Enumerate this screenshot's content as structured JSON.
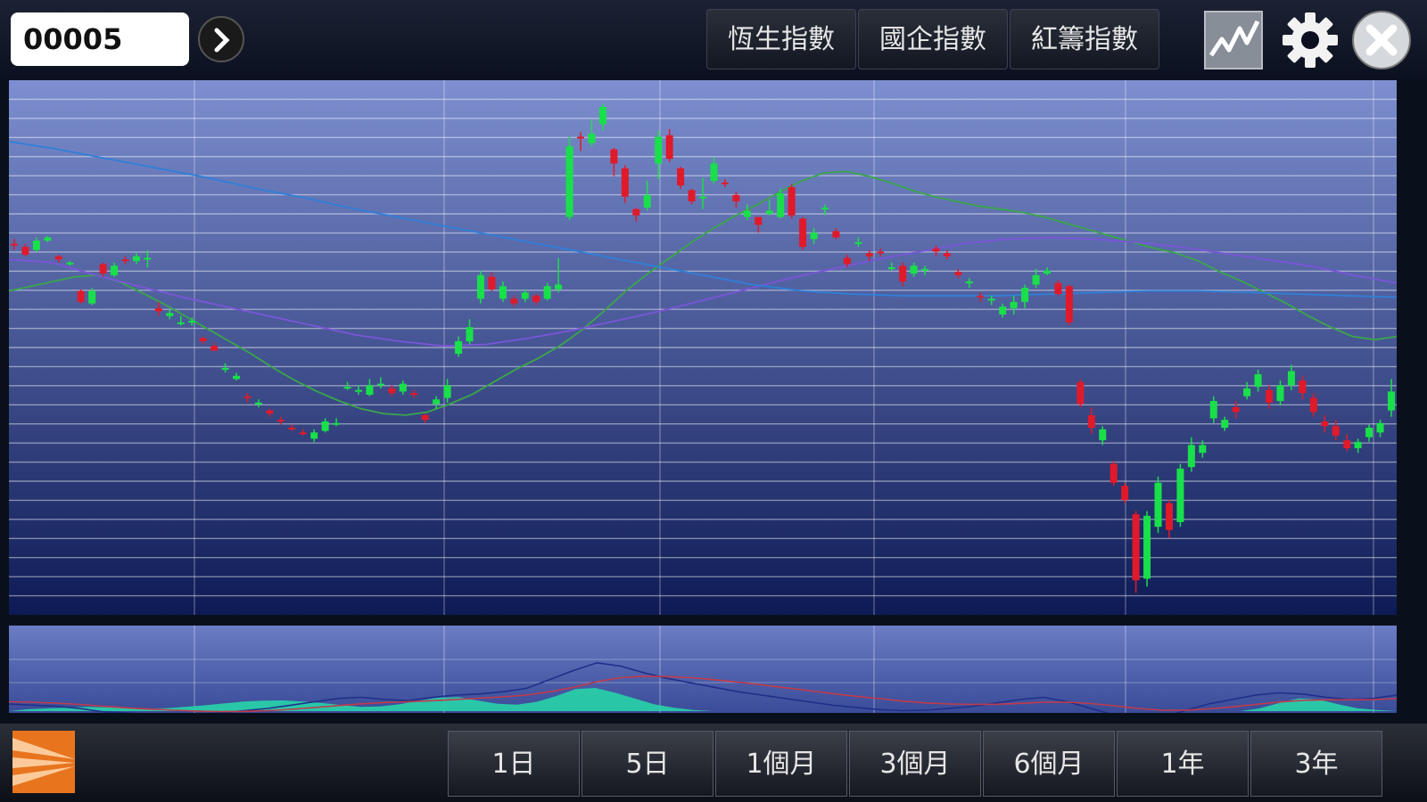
{
  "search": {
    "value": "00005"
  },
  "index_buttons": [
    {
      "label": "恆生指數"
    },
    {
      "label": "國企指數"
    },
    {
      "label": "紅籌指數"
    }
  ],
  "period_buttons": [
    {
      "label": "1日"
    },
    {
      "label": "5日"
    },
    {
      "label": "1個月"
    },
    {
      "label": "3個月"
    },
    {
      "label": "6個月"
    },
    {
      "label": "1年"
    },
    {
      "label": "3年"
    }
  ],
  "icons": {
    "go": "chevron-right-icon",
    "chart_type": "line-chart-icon",
    "settings": "gear-icon",
    "close": "close-icon",
    "logo": "brand-logo"
  },
  "colors": {
    "up": "#19e04a",
    "down": "#e01a2a",
    "ma_short": "#3aa64a",
    "ma_mid": "#7a55d8",
    "ma_long": "#2f7fd8",
    "plot_top": "#7d8fd0",
    "plot_bottom": "#0d1a55",
    "histogram": "#27d4a8"
  },
  "chart_data": {
    "type": "candlestick",
    "y_axis": "right",
    "grid": true,
    "candles": [
      [
        75.6,
        75.5,
        75.9,
        75.2
      ],
      [
        75.4,
        74.9,
        75.6,
        74.8
      ],
      [
        75.2,
        75.8,
        76.0,
        75.1
      ],
      [
        75.8,
        76.0,
        76.1,
        75.7
      ],
      [
        74.8,
        74.6,
        74.9,
        74.4
      ],
      [
        74.3,
        74.4,
        74.5,
        74.2
      ],
      [
        72.6,
        71.9,
        72.7,
        71.8
      ],
      [
        71.8,
        72.6,
        72.8,
        71.7
      ],
      [
        74.3,
        73.7,
        74.4,
        73.5
      ],
      [
        73.6,
        74.2,
        74.4,
        73.5
      ],
      [
        74.6,
        74.5,
        74.8,
        74.3
      ],
      [
        74.5,
        74.8,
        75.0,
        74.3
      ],
      [
        74.7,
        74.7,
        75.2,
        74.1
      ],
      [
        71.5,
        71.3,
        71.9,
        71.0
      ],
      [
        71.0,
        71.2,
        71.4,
        70.8
      ],
      [
        70.6,
        70.6,
        71.0,
        70.4
      ],
      [
        70.7,
        70.7,
        70.9,
        70.4
      ],
      [
        69.6,
        69.4,
        69.7,
        69.2
      ],
      [
        69.1,
        68.8,
        69.3,
        68.8
      ],
      [
        67.7,
        67.7,
        68.0,
        67.4
      ],
      [
        67.0,
        67.2,
        67.4,
        66.9
      ],
      [
        65.9,
        65.8,
        66.1,
        65.5
      ],
      [
        65.4,
        65.5,
        65.7,
        65.2
      ],
      [
        65.0,
        64.8,
        65.1,
        64.6
      ],
      [
        64.4,
        64.3,
        64.6,
        64.1
      ],
      [
        63.9,
        63.8,
        64.1,
        63.7
      ],
      [
        63.6,
        63.5,
        63.8,
        63.4
      ],
      [
        63.2,
        63.6,
        63.8,
        63.0
      ],
      [
        63.7,
        64.3,
        64.5,
        63.6
      ],
      [
        64.1,
        64.2,
        64.5,
        64.0
      ],
      [
        66.4,
        66.5,
        66.8,
        66.3
      ],
      [
        66.3,
        66.3,
        66.6,
        66.0
      ],
      [
        66.0,
        66.6,
        67.0,
        65.9
      ],
      [
        66.6,
        66.7,
        67.1,
        66.4
      ],
      [
        66.4,
        66.1,
        66.6,
        65.9
      ],
      [
        66.2,
        66.7,
        66.9,
        66.0
      ],
      [
        66.1,
        66.0,
        66.3,
        65.8
      ],
      [
        64.7,
        64.4,
        64.8,
        64.2
      ],
      [
        65.4,
        65.7,
        65.9,
        65.1
      ],
      [
        65.8,
        66.6,
        67.0,
        65.5
      ],
      [
        68.6,
        69.4,
        69.7,
        68.4
      ],
      [
        69.4,
        70.3,
        70.8,
        69.2
      ],
      [
        72.1,
        73.6,
        73.9,
        71.8
      ],
      [
        73.5,
        72.7,
        73.8,
        72.6
      ],
      [
        72.1,
        72.9,
        73.2,
        71.9
      ],
      [
        72.1,
        71.8,
        72.3,
        71.6
      ],
      [
        72.1,
        72.5,
        72.7,
        71.9
      ],
      [
        72.3,
        71.9,
        72.4,
        71.7
      ],
      [
        72.1,
        72.9,
        73.1,
        72.0
      ],
      [
        72.7,
        73.0,
        74.7,
        72.5
      ],
      [
        77.3,
        81.8,
        82.4,
        77.1
      ],
      [
        82.4,
        82.3,
        82.7,
        81.5
      ],
      [
        82.0,
        82.6,
        83.5,
        81.8
      ],
      [
        83.2,
        84.3,
        84.5,
        82.8
      ],
      [
        81.6,
        80.7,
        81.7,
        79.9
      ],
      [
        80.4,
        78.6,
        80.6,
        78.2
      ],
      [
        77.8,
        77.4,
        77.9,
        77.0
      ],
      [
        77.9,
        78.7,
        79.6,
        77.7
      ],
      [
        80.7,
        82.4,
        82.8,
        79.7
      ],
      [
        82.5,
        81.0,
        82.9,
        80.8
      ],
      [
        80.4,
        79.3,
        80.5,
        79.1
      ],
      [
        79.0,
        78.3,
        79.1,
        78.1
      ],
      [
        78.6,
        78.6,
        79.8,
        77.8
      ],
      [
        79.6,
        80.7,
        81.1,
        79.4
      ],
      [
        79.5,
        79.4,
        79.7,
        79.2
      ],
      [
        78.7,
        78.3,
        78.9,
        77.9
      ],
      [
        77.3,
        77.7,
        78.1,
        77.1
      ],
      [
        77.3,
        76.8,
        77.3,
        76.3
      ],
      [
        77.5,
        77.7,
        78.4,
        77.4
      ],
      [
        77.3,
        78.8,
        79.1,
        77.2
      ],
      [
        79.2,
        77.4,
        79.4,
        77.2
      ],
      [
        77.2,
        75.4,
        77.3,
        75.2
      ],
      [
        75.9,
        76.3,
        76.6,
        75.6
      ],
      [
        77.8,
        77.9,
        78.1,
        77.4
      ],
      [
        76.4,
        76.0,
        76.6,
        75.9
      ],
      [
        74.7,
        74.3,
        74.9,
        74.1
      ],
      [
        75.6,
        75.7,
        76.0,
        75.4
      ],
      [
        75.0,
        74.8,
        75.2,
        74.5
      ],
      [
        75.1,
        75.0,
        75.3,
        74.8
      ],
      [
        74.1,
        74.1,
        74.4,
        73.9
      ],
      [
        74.2,
        73.2,
        74.4,
        72.9
      ],
      [
        73.7,
        74.2,
        74.4,
        73.5
      ],
      [
        73.9,
        74.0,
        74.2,
        73.6
      ],
      [
        75.3,
        75.1,
        75.5,
        74.8
      ],
      [
        75.0,
        74.8,
        75.2,
        74.6
      ],
      [
        73.8,
        73.6,
        74.0,
        73.4
      ],
      [
        73.1,
        73.2,
        73.4,
        72.8
      ],
      [
        72.3,
        72.2,
        72.5,
        71.9
      ],
      [
        72.0,
        72.1,
        72.3,
        71.7
      ],
      [
        71.1,
        71.6,
        71.8,
        70.9
      ],
      [
        71.5,
        71.9,
        72.3,
        71.1
      ],
      [
        71.9,
        72.8,
        73.0,
        71.5
      ],
      [
        73.0,
        73.6,
        74.0,
        72.8
      ],
      [
        73.7,
        73.9,
        74.1,
        73.6
      ],
      [
        73.1,
        72.4,
        73.3,
        72.3
      ],
      [
        72.9,
        70.6,
        73.0,
        70.4
      ],
      [
        66.8,
        65.4,
        67.0,
        65.2
      ],
      [
        64.7,
        63.9,
        65.2,
        63.5
      ],
      [
        63.1,
        63.8,
        64.0,
        62.8
      ],
      [
        61.6,
        60.4,
        61.8,
        60.2
      ],
      [
        60.2,
        59.3,
        60.4,
        59.1
      ],
      [
        58.4,
        54.2,
        58.6,
        53.4
      ],
      [
        54.3,
        58.3,
        58.6,
        53.8
      ],
      [
        57.6,
        60.4,
        60.8,
        57.2
      ],
      [
        59.1,
        57.4,
        59.3,
        56.9
      ],
      [
        57.9,
        61.3,
        61.6,
        57.6
      ],
      [
        61.4,
        62.8,
        63.3,
        61.1
      ],
      [
        62.3,
        62.8,
        63.1,
        62.0
      ],
      [
        64.5,
        65.6,
        65.9,
        64.2
      ],
      [
        63.9,
        64.4,
        64.6,
        63.7
      ],
      [
        65.2,
        64.9,
        65.6,
        64.5
      ],
      [
        65.9,
        66.4,
        66.8,
        65.7
      ],
      [
        66.5,
        67.3,
        67.6,
        66.2
      ],
      [
        66.3,
        65.5,
        66.6,
        65.1
      ],
      [
        65.6,
        66.6,
        66.9,
        65.3
      ],
      [
        66.6,
        67.5,
        67.9,
        66.3
      ],
      [
        66.9,
        66.1,
        67.2,
        65.7
      ],
      [
        65.8,
        64.9,
        66.1,
        64.6
      ],
      [
        64.3,
        64.0,
        64.7,
        63.6
      ],
      [
        64.0,
        63.4,
        64.4,
        63.1
      ],
      [
        63.1,
        62.6,
        63.5,
        62.4
      ],
      [
        62.6,
        63.0,
        63.2,
        62.3
      ],
      [
        63.3,
        63.9,
        64.1,
        63.0
      ],
      [
        63.6,
        64.2,
        64.4,
        63.3
      ],
      [
        65.0,
        66.2,
        67.0,
        64.6
      ]
    ],
    "series": [
      {
        "values": [
          72.6,
          72.9,
          73.2,
          73.5,
          73.6,
          73.2,
          72.5,
          71.8,
          71.0,
          70.2,
          69.4,
          68.6,
          67.7,
          66.9,
          66.2,
          65.6,
          65.1,
          64.8,
          64.7,
          64.9,
          65.4,
          66.0,
          66.8,
          67.6,
          68.3,
          69.1,
          70.1,
          71.3,
          72.6,
          73.7,
          74.7,
          75.7,
          76.6,
          77.4,
          78.1,
          78.9,
          79.6,
          80.1,
          80.2,
          79.9,
          79.5,
          79.0,
          78.6,
          78.3,
          78.0,
          77.8,
          77.6,
          77.3,
          76.9,
          76.5,
          76.1,
          75.7,
          75.3,
          75.0,
          74.5,
          73.8,
          73.2,
          72.5,
          71.8,
          71.0,
          70.3,
          69.7,
          69.5,
          69.7
        ]
      },
      {
        "values": [
          74.6,
          74.4,
          73.6,
          72.9,
          72.2,
          71.6,
          71.0,
          70.4,
          69.8,
          69.4,
          69.1,
          69.2,
          69.6,
          70.1,
          70.7,
          71.3,
          72.0,
          72.7,
          73.4,
          74.0,
          74.6,
          75.1,
          75.6,
          75.9,
          76.0,
          75.9,
          75.7,
          75.4,
          75.0,
          74.6,
          74.2,
          73.6,
          73.1
        ]
      },
      {
        "values": [
          82.1,
          81.6,
          81.0,
          80.4,
          79.8,
          79.1,
          78.5,
          77.8,
          77.2,
          76.6,
          76.0,
          75.4,
          74.8,
          74.2,
          73.6,
          73.0,
          72.6,
          72.4,
          72.3,
          72.3,
          72.3,
          72.4,
          72.5,
          72.6,
          72.6,
          72.5,
          72.4,
          72.3,
          72.2
        ]
      }
    ],
    "macd": {
      "histogram": [
        0.0,
        0.08,
        0.12,
        0.15,
        0.18,
        0.16,
        0.12,
        0.1,
        0.12,
        0.18,
        0.25,
        0.33,
        0.41,
        0.45,
        0.46,
        0.42,
        0.35,
        0.26,
        0.18,
        0.2,
        0.3,
        0.45,
        0.58,
        0.6,
        0.45,
        0.32,
        0.28,
        0.4,
        0.65,
        0.95,
        1.0,
        0.8,
        0.55,
        0.3,
        0.15,
        0.05,
        0.0,
        0.0,
        0.0,
        0.0,
        0.0,
        0.0,
        0.0,
        0.0,
        0.0,
        0.0,
        0.0,
        0.0,
        0.0,
        0.0,
        0.0,
        0.0,
        0.0,
        0.0,
        0.0,
        0.0,
        0.0,
        0.0,
        0.0,
        0.0,
        0.0,
        0.0,
        0.0,
        0.0,
        0.12,
        0.35,
        0.55,
        0.5,
        0.3,
        0.12,
        0.05,
        0.0
      ],
      "diff": [
        -0.4,
        -0.45,
        -0.5,
        -0.6,
        -0.75,
        -0.8,
        -0.85,
        -0.88,
        -0.85,
        -0.8,
        -0.7,
        -0.6,
        -0.45,
        -0.3,
        -0.15,
        -0.1,
        -0.2,
        -0.25,
        -0.1,
        0.0,
        0.05,
        0.15,
        0.3,
        0.7,
        1.1,
        1.45,
        1.3,
        1.0,
        0.75,
        0.55,
        0.35,
        0.15,
        0.0,
        -0.15,
        -0.3,
        -0.45,
        -0.55,
        -0.65,
        -0.7,
        -0.68,
        -0.6,
        -0.5,
        -0.35,
        -0.2,
        -0.1,
        -0.3,
        -0.6,
        -0.9,
        -1.1,
        -1.0,
        -0.7,
        -0.4,
        -0.2,
        0.0,
        0.1,
        0.05,
        -0.1,
        -0.2,
        -0.15,
        0.0
      ],
      "dea": [
        -0.3,
        -0.32,
        -0.36,
        -0.42,
        -0.5,
        -0.57,
        -0.63,
        -0.68,
        -0.72,
        -0.74,
        -0.73,
        -0.7,
        -0.64,
        -0.56,
        -0.47,
        -0.39,
        -0.33,
        -0.3,
        -0.25,
        -0.2,
        -0.14,
        -0.08,
        0.0,
        0.15,
        0.35,
        0.6,
        0.78,
        0.85,
        0.83,
        0.78,
        0.69,
        0.58,
        0.46,
        0.33,
        0.2,
        0.07,
        -0.05,
        -0.16,
        -0.27,
        -0.35,
        -0.4,
        -0.42,
        -0.41,
        -0.37,
        -0.32,
        -0.32,
        -0.38,
        -0.48,
        -0.6,
        -0.68,
        -0.68,
        -0.62,
        -0.53,
        -0.42,
        -0.31,
        -0.24,
        -0.21,
        -0.21,
        -0.2,
        -0.16
      ]
    }
  }
}
